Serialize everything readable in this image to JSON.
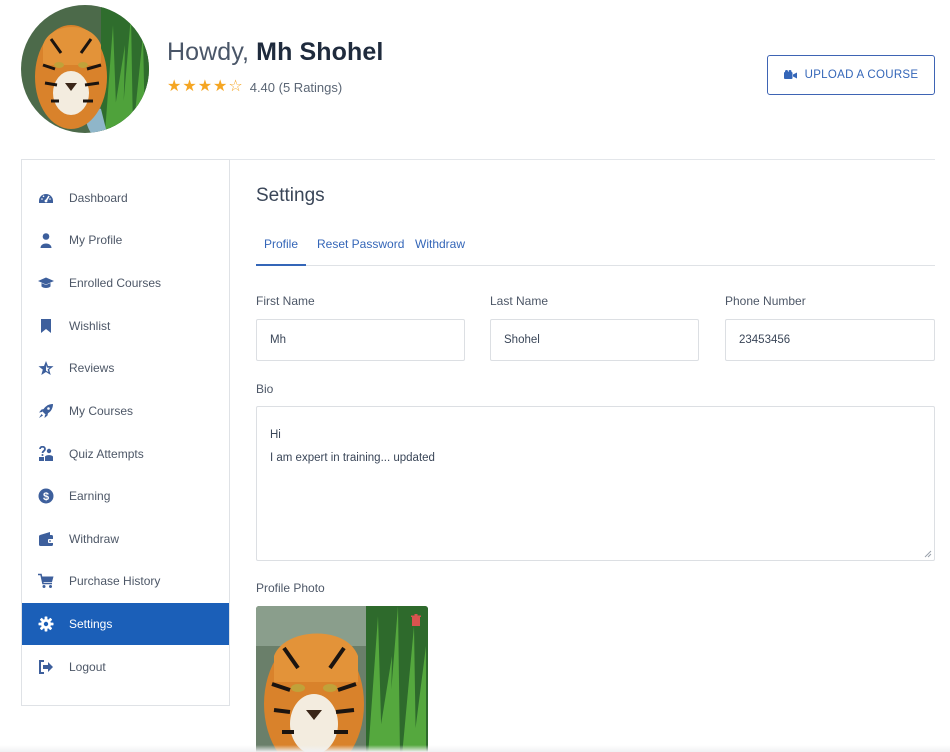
{
  "header": {
    "greeting_prefix": "Howdy,",
    "user_name": "Mh Shohel",
    "rating": {
      "value": 4.4,
      "stars_full": 4,
      "stars_total": 5,
      "text": "4.40 (5 Ratings)"
    },
    "upload_button_label": "UPLOAD A COURSE",
    "upload_button_icon": "video-camera-icon"
  },
  "sidebar": {
    "items": [
      {
        "label": "Dashboard",
        "icon": "dashboard-gauge-icon"
      },
      {
        "label": "My Profile",
        "icon": "user-icon"
      },
      {
        "label": "Enrolled Courses",
        "icon": "graduation-cap-icon"
      },
      {
        "label": "Wishlist",
        "icon": "bookmark-icon"
      },
      {
        "label": "Reviews",
        "icon": "star-icon"
      },
      {
        "label": "My Courses",
        "icon": "rocket-icon"
      },
      {
        "label": "Quiz Attempts",
        "icon": "quiz-icon"
      },
      {
        "label": "Earning",
        "icon": "dollar-coin-icon"
      },
      {
        "label": "Withdraw",
        "icon": "wallet-icon"
      },
      {
        "label": "Purchase History",
        "icon": "cart-icon"
      },
      {
        "label": "Settings",
        "icon": "gear-icon",
        "active": true
      },
      {
        "label": "Logout",
        "icon": "logout-icon"
      }
    ]
  },
  "main": {
    "title": "Settings",
    "tabs": [
      {
        "label": "Profile",
        "active": true
      },
      {
        "label": "Reset Password"
      },
      {
        "label": "Withdraw"
      }
    ],
    "form": {
      "first_name": {
        "label": "First Name",
        "value": "Mh"
      },
      "last_name": {
        "label": "Last Name",
        "value": "Shohel"
      },
      "phone": {
        "label": "Phone Number",
        "value": "23453456"
      },
      "bio": {
        "label": "Bio",
        "lines": [
          "Hi",
          "I am expert in training... updated"
        ]
      },
      "photo": {
        "label": "Profile Photo"
      }
    }
  },
  "colors": {
    "accent": "#1b5fb8",
    "link": "#3466b8",
    "star": "#f5a623",
    "icon": "#3d5f9c"
  }
}
